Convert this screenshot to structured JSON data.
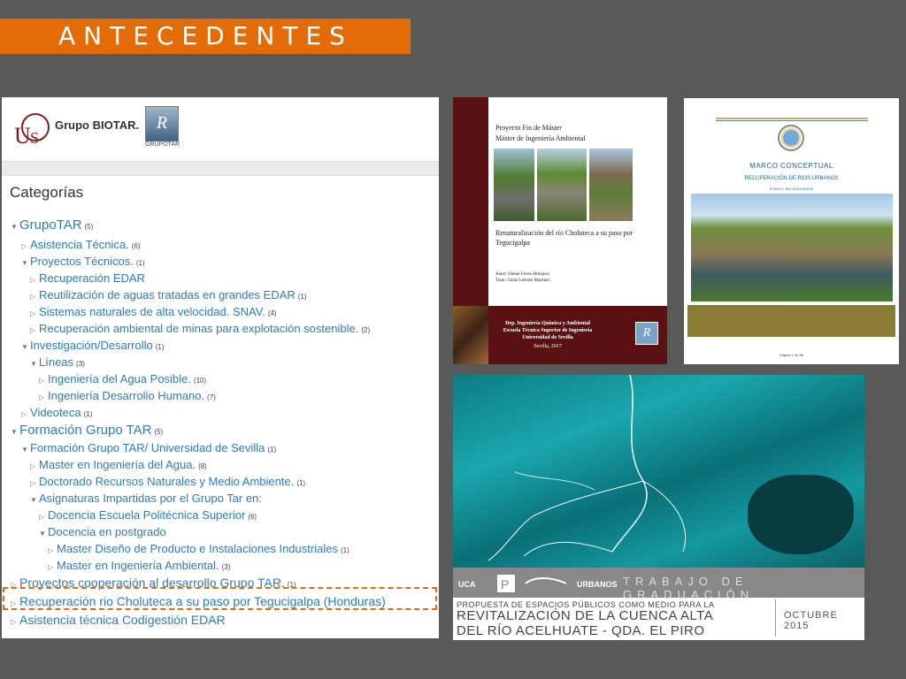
{
  "slide_title": "ANTECEDENTES",
  "colors": {
    "accent": "#E36C09",
    "link": "#2c7cbf",
    "background": "#595959"
  },
  "website": {
    "logo_text": "Grupo BIOTAR.",
    "logo_tar_letter": "R",
    "logo_tar_label": "GRUPOTAR",
    "categories_title": "Categorías",
    "tree": [
      {
        "label": "GrupoTAR",
        "count": "(5)",
        "expanded": true
      },
      {
        "label": "Asistencia Técnica.",
        "count": "(6)",
        "expanded": false
      },
      {
        "label": "Proyectos Técnicos.",
        "count": "(1)",
        "expanded": true
      },
      {
        "label": "Recuperación EDAR",
        "count": "",
        "expanded": false
      },
      {
        "label": "Reutilización de aguas tratadas en grandes EDAR",
        "count": "(1)",
        "expanded": false
      },
      {
        "label": "Sistemas naturales de alta velocidad. SNAV.",
        "count": "(4)",
        "expanded": false
      },
      {
        "label": "Recuperación ambiental de minas para explotación sostenible.",
        "count": "(2)",
        "expanded": false
      },
      {
        "label": "Investigación/Desarrollo",
        "count": "(1)",
        "expanded": true
      },
      {
        "label": "Líneas",
        "count": "(3)",
        "expanded": true
      },
      {
        "label": "Ingeniería del Agua Posible.",
        "count": "(10)",
        "expanded": false
      },
      {
        "label": "Ingeniería Desarrollo Humano.",
        "count": "(7)",
        "expanded": false
      },
      {
        "label": "Videoteca",
        "count": "(1)",
        "expanded": false
      },
      {
        "label": "Formación Grupo TAR",
        "count": "(5)",
        "expanded": true
      },
      {
        "label": "Formación Grupo TAR/ Universidad de Sevilla",
        "count": "(1)",
        "expanded": true
      },
      {
        "label": "Master en Ingeniería del Agua.",
        "count": "(8)",
        "expanded": false
      },
      {
        "label": "Doctorado Recursos Naturales y Medio Ambiente.",
        "count": "(1)",
        "expanded": false
      },
      {
        "label": "Asignaturas Impartidas por el Grupo Tar en:",
        "count": "",
        "expanded": true
      },
      {
        "label": "Docencia Escuela Politécnica Superior",
        "count": "(6)",
        "expanded": false
      },
      {
        "label": "Docencia en postgrado",
        "count": "",
        "expanded": true
      },
      {
        "label": "Master Diseño de Producto e Instalaciones Industriales",
        "count": "(1)",
        "expanded": false
      },
      {
        "label": "Master en Ingeniería Ambiental.",
        "count": "(3)",
        "expanded": false
      },
      {
        "label": "Proyectos cooperación al desarrollo Grupo TAR.",
        "count": "(1)",
        "expanded": false
      },
      {
        "label": "Recuperación rio Choluteca a su paso por Tegucigalpa (Honduras)",
        "count": "",
        "expanded": false
      },
      {
        "label": "Asistencia técnica Codigestión EDAR",
        "count": "",
        "expanded": false
      }
    ]
  },
  "cover1": {
    "line1": "Proyecto Fin de Máster",
    "line2": "Máster de Ingeniería Ambiental",
    "title": "Renaturalización del río Choluteca a su paso por Tegucigalpa",
    "author": "Autor: Daniel Flores Hinojosa",
    "tutor": "Tutor: Julián Lebrato Martínez",
    "dept1": "Dep. Ingeniería Química y Ambiental",
    "dept2": "Escuela Técnica Superior de Ingeniería",
    "dept3": "Universidad de Sevilla",
    "city": "Sevilla, 2017",
    "logo_letter": "R"
  },
  "cover2": {
    "title": "MARCO CONCEPTUAL",
    "subtitle": "RECUPERACIÓN DE RÍOS URBANOS",
    "stage": "ETAPA 2: RÍO ACELHUATE",
    "page": "Página 1 de 86"
  },
  "map_cover": {
    "strip_text": "TRABAJO DE GRADUACIÓN",
    "logo1": "UCA",
    "logo3": "URBANOS",
    "line1": "PROPUESTA DE ESPACIOS PÚBLICOS COMO MEDIO PARA LA",
    "line2": "REVITALIZACIÓN DE LA CUENCA ALTA",
    "line3": "DEL RÍO ACELHUATE - QDA. EL PIRO",
    "date": "OCTUBRE 2015"
  }
}
